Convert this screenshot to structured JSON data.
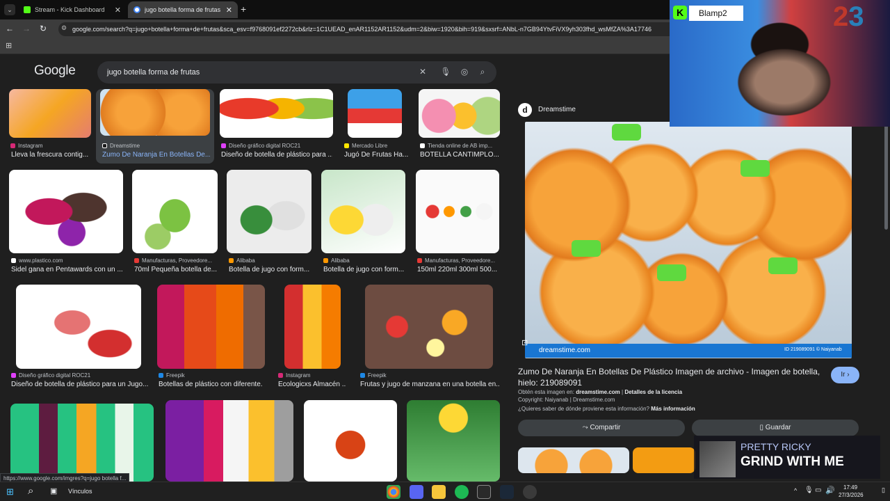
{
  "tabs": [
    {
      "label": "Stream - Kick Dashboard"
    },
    {
      "label": "jugo botella forma de frutas - B"
    }
  ],
  "address": {
    "url": "google.com/search?q=jugo+botella+forma+de+frutas&sca_esv=f9768091ef2272cb&rlz=1C1UEAD_enAR1152AR1152&udm=2&biw=1920&bih=919&sxsrf=ANbL-n7GB94YtvFiVX9yh303fhd_wsMfZA%3A17746"
  },
  "google": {
    "logo": "Google",
    "query": "jugo botella forma de frutas"
  },
  "results": [
    {
      "src": "Instagram",
      "title": "Lleva la frescura contig..."
    },
    {
      "src": "Dreamstime",
      "title": "Zumo De Naranja En Botellas De..."
    },
    {
      "src": "Diseño gráfico digital ROC21",
      "title": "Diseño de botella de plástico para ..."
    },
    {
      "src": "Mercado Libre",
      "title": "Jugó De Frutas Ha..."
    },
    {
      "src": "Tienda online de AB imp...",
      "title": "BOTELLA CANTIMPLO..."
    },
    {
      "src": "www.plastico.com",
      "title": "Sidel gana en Pentawards con un ..."
    },
    {
      "src": "Manufacturas, Proveedore...",
      "title": "70ml Pequeña botella de..."
    },
    {
      "src": "Alibaba",
      "title": "Botella de jugo con form..."
    },
    {
      "src": "Alibaba",
      "title": "Botella de jugo con form..."
    },
    {
      "src": "Manufacturas, Proveedore...",
      "title": "150ml 220ml 300ml 500..."
    },
    {
      "src": "Diseño gráfico digital ROC21",
      "title": "Diseño de botella de plástico para un Jugo..."
    },
    {
      "src": "Freepik",
      "title": "Botellas de plástico con diferente..."
    },
    {
      "src": "Instagram",
      "title": "Ecologicxs Almacén ..."
    },
    {
      "src": "Freepik",
      "title": "Frutas y jugo de manzana en una botella en..."
    }
  ],
  "panel": {
    "source": "Dreamstime",
    "watermark": "dreamstime.com",
    "imgid": "ID 219089091 © Naiyanab",
    "title": "Zumo De Naranja En Botellas De Plástico Imagen de archivo - Imagen de botella, hielo: 219089091",
    "visit": "Ir",
    "found_prefix": "Obtén esta imagen en:",
    "found_site": "dreamstime.com",
    "license": "Detalles de la licencia",
    "copyright": "Copyright: Naiyanab | Dreamstime.com",
    "question": "¿Quieres saber de dónde proviene esta información?",
    "more": "Más información",
    "share": "Compartir",
    "save": "Guardar"
  },
  "stream": {
    "name": "Blamp2",
    "song_artist": "PRETTY RICKY",
    "song_title": "GRIND WITH ME"
  },
  "statusbar": {
    "url": "https://www.google.com/imgres?q=jugo botella f..."
  },
  "taskbar": {
    "search": "Vínculos",
    "time": "17:49",
    "date": "27/3/2026"
  }
}
